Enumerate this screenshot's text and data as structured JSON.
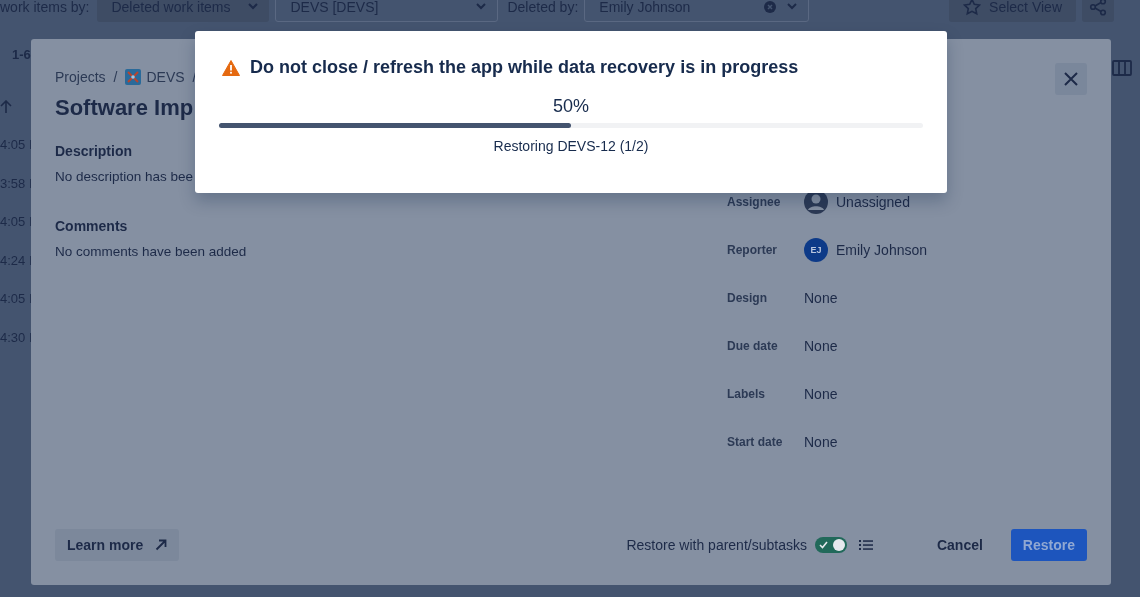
{
  "top_bar": {
    "filter_label": "work items by:",
    "filter_value": "Deleted work items",
    "project_value": "DEVS [DEVS]",
    "deleted_by_label": "Deleted by:",
    "deleted_by_value": "Emily Johnson",
    "select_view": "Select View"
  },
  "list": {
    "range": "1-6",
    "times": [
      "4:05 I",
      "3:58 I",
      "4:05 I",
      "4:24 I",
      "4:05 I",
      "4:30 I"
    ]
  },
  "modal": {
    "breadcrumb": [
      {
        "text": "Projects",
        "kind": "link"
      },
      {
        "text": "/",
        "kind": "separator"
      },
      {
        "text": "DEVS",
        "kind": "project"
      },
      {
        "text": "/",
        "kind": "separator"
      }
    ],
    "title": "Software Imp",
    "sections": [
      {
        "heading": "Description",
        "text": "No description has bee"
      },
      {
        "heading": "Comments",
        "text": "No comments have been added"
      }
    ],
    "fields": [
      {
        "label": "Assignee",
        "value": "Unassigned",
        "kind": "placeholder-avatar"
      },
      {
        "label": "Reporter",
        "value": "Emily Johnson",
        "kind": "initials-avatar",
        "initials": "EJ"
      },
      {
        "label": "Design",
        "value": "None",
        "kind": "text"
      },
      {
        "label": "Due date",
        "value": "None",
        "kind": "text"
      },
      {
        "label": "Labels",
        "value": "None",
        "kind": "text"
      },
      {
        "label": "Start date",
        "value": "None",
        "kind": "text"
      }
    ],
    "footer": {
      "learn_more": "Learn more",
      "restore_with_parent": {
        "label": "Restore with parent/subtasks",
        "on": true
      },
      "cancel": "Cancel",
      "restore": "Restore"
    }
  },
  "progress": {
    "title": "Do not close / refresh the app while data recovery is in progress",
    "percent": "50%",
    "level": 0.5,
    "status": "Restoring DEVS-12 (1/2)"
  }
}
